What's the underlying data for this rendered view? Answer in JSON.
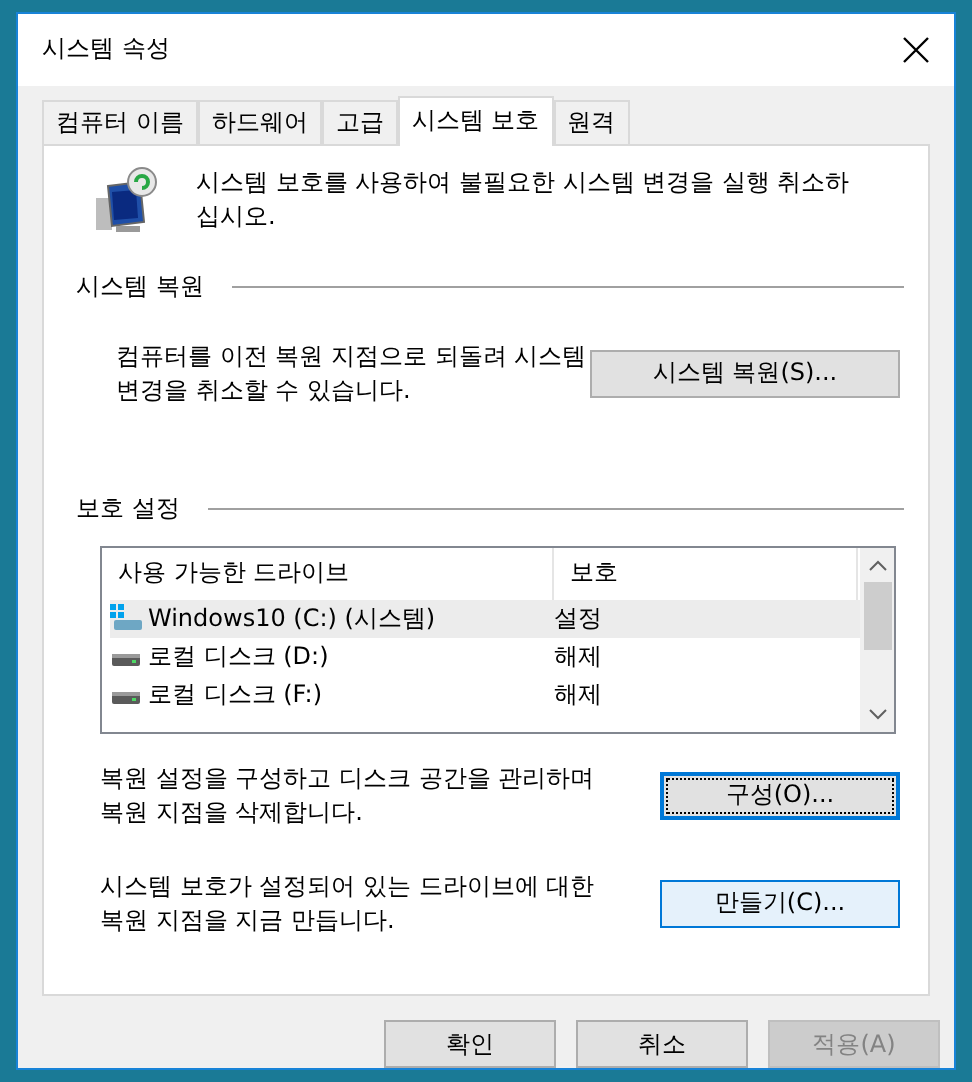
{
  "window": {
    "title": "시스템 속성"
  },
  "tabs": [
    {
      "label": "컴퓨터 이름",
      "selected": false
    },
    {
      "label": "하드웨어",
      "selected": false
    },
    {
      "label": "고급",
      "selected": false
    },
    {
      "label": "시스템 보호",
      "selected": true
    },
    {
      "label": "원격",
      "selected": false
    }
  ],
  "intro": "시스템 보호를 사용하여 불필요한 시스템 변경을 실행 취소하\n십시오.",
  "restore": {
    "heading": "시스템 복원",
    "text": "컴퓨터를 이전 복원 지점으로 되돌려 시스템\n변경을 취소할 수 있습니다.",
    "button": {
      "label": "시스템 복원(S)...",
      "focused": false,
      "hovered": false
    }
  },
  "protection": {
    "heading": "보호 설정",
    "columns": [
      "사용 가능한 드라이브",
      "보호"
    ],
    "rows": [
      {
        "drive": "Windows10 (C:) (시스템)",
        "protection": "설정",
        "kind": "system",
        "selected": true
      },
      {
        "drive": "로컬 디스크 (D:)",
        "protection": "해제",
        "kind": "disk",
        "selected": false
      },
      {
        "drive": "로컬 디스크 (F:)",
        "protection": "해제",
        "kind": "disk",
        "selected": false
      }
    ],
    "actions": [
      {
        "text": "복원 설정을 구성하고 디스크 공간을 관리하며\n복원 지점을 삭제합니다.",
        "button": {
          "label": "구성(O)...",
          "focused": true,
          "hovered": false
        }
      },
      {
        "text": "시스템 보호가 설정되어 있는 드라이브에 대한\n복원 지점을 지금 만듭니다.",
        "button": {
          "label": "만들기(C)...",
          "focused": false,
          "hovered": true
        }
      }
    ]
  },
  "buttons": [
    {
      "label": "확인",
      "disabled": false
    },
    {
      "label": "취소",
      "disabled": false
    },
    {
      "label": "적용(A)",
      "disabled": true
    }
  ]
}
